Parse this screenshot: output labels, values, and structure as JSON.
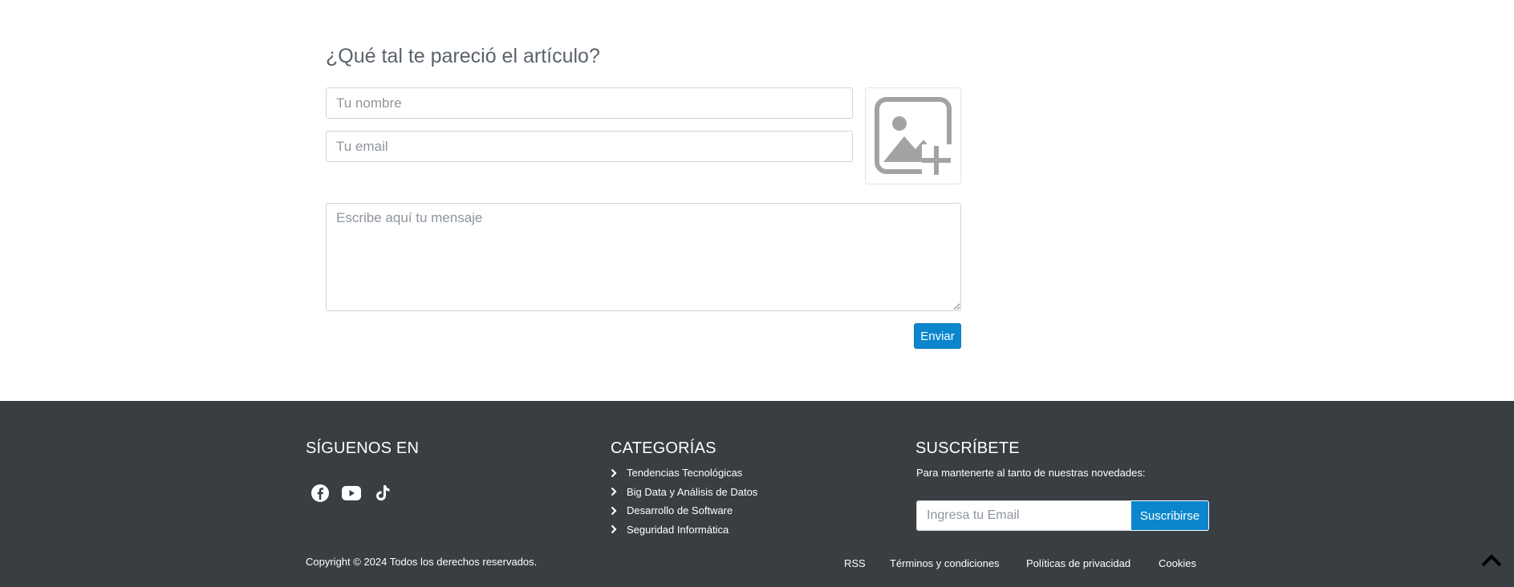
{
  "form": {
    "title": "¿Qué tal te pareció el artículo?",
    "name_placeholder": "Tu nombre",
    "email_placeholder": "Tu email",
    "message_placeholder": "Escribe aquí tu mensaje",
    "image_icon": "add-image-icon",
    "submit_label": "Enviar"
  },
  "footer": {
    "follow": {
      "title": "SÍGUENOS EN",
      "icons": [
        "facebook-icon",
        "youtube-icon",
        "tiktok-icon"
      ]
    },
    "categories": {
      "title": "CATEGORÍAS",
      "items": [
        "Tendencias Tecnológicas",
        "Big Data y Análisis de Datos",
        "Desarrollo de Software",
        "Seguridad Informática"
      ]
    },
    "subscribe": {
      "title": "SUSCRÍBETE",
      "text": "Para mantenerte al tanto de nuestras novedades:",
      "email_placeholder": "Ingresa tu Email",
      "button_label": "Suscribirse"
    },
    "copyright": "Copyright © 2024 Todos los derechos reservados.",
    "links": [
      "RSS",
      "Términos y condiciones",
      "Políticas de privacidad",
      "Cookies"
    ],
    "back_to_top_icon": "chevron-up-icon"
  },
  "colors": {
    "accent": "#0b86cd",
    "footer_bg": "#393e43",
    "title_text": "#5a626b"
  }
}
